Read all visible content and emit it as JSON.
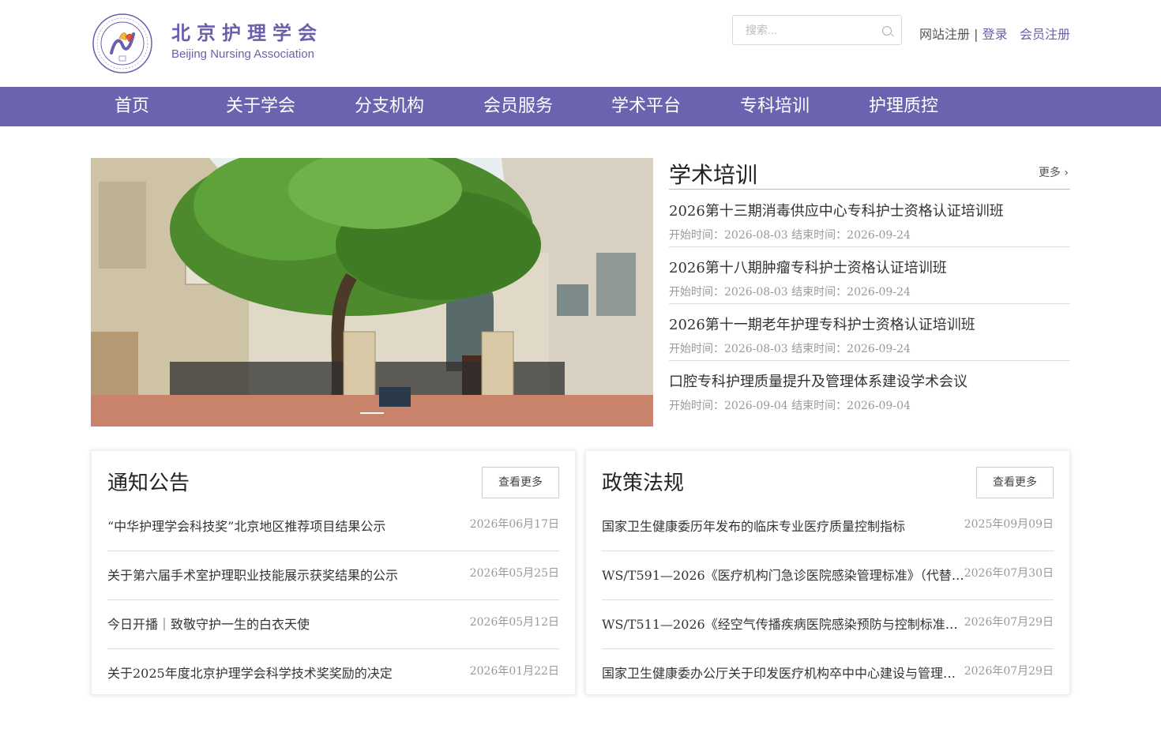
{
  "header": {
    "brand_cn": "北京护理学会",
    "brand_en": "Beijing Nursing Association",
    "search_placeholder": "搜索...",
    "site_register": "网站注册",
    "separator": "|",
    "login": "登录",
    "member_register": "会员注册",
    "brand_color": "#6a5fab"
  },
  "nav": {
    "items": [
      "首页",
      "关于学会",
      "分支机构",
      "会员服务",
      "学术平台",
      "专科培训",
      "护理质控"
    ],
    "bg_color": "#6b63b0"
  },
  "training": {
    "title": "学术培训",
    "more": "更多",
    "items": [
      {
        "title": "2026第十三期消毒供应中心专科护士资格认证培训班",
        "time": "开始时间：2026-08-03   结束时间：2026-09-24"
      },
      {
        "title": "2026第十八期肿瘤专科护士资格认证培训班",
        "time": "开始时间：2026-08-03   结束时间：2026-09-24"
      },
      {
        "title": "2026第十一期老年护理专科护士资格认证培训班",
        "time": "开始时间：2026-08-03   结束时间：2026-09-24"
      },
      {
        "title": "口腔专科护理质量提升及管理体系建设学术会议",
        "time": "开始时间：2026-09-04   结束时间：2026-09-04"
      }
    ]
  },
  "notices": {
    "title": "通知公告",
    "more": "查看更多",
    "items": [
      {
        "title": "“中华护理学会科技奖”北京地区推荐项目结果公示",
        "date": "2026年06月17日"
      },
      {
        "title": "关于第六届手术室护理职业技能展示获奖结果的公示",
        "date": "2026年05月25日"
      },
      {
        "title": "今日开播｜致敬守护一生的白衣天使",
        "date": "2026年05月12日"
      },
      {
        "title": "关于2025年度北京护理学会科学技术奖奖励的决定",
        "date": "2026年01月22日"
      }
    ]
  },
  "policies": {
    "title": "政策法规",
    "more": "查看更多",
    "items": [
      {
        "title": "国家卫生健康委历年发布的临床专业医疗质量控制指标",
        "date": "2025年09月09日"
      },
      {
        "title": "WS/T591—2026《医疗机构门急诊医院感染管理标准》（代替…",
        "date": "2026年07月30日"
      },
      {
        "title": "WS/T511—2026《经空气传播疾病医院感染预防与控制标准》…",
        "date": "2026年07月29日"
      },
      {
        "title": "国家卫生健康委办公厅关于印发医疗机构卒中中心建设与管理…",
        "date": "2026年07月29日"
      }
    ]
  }
}
